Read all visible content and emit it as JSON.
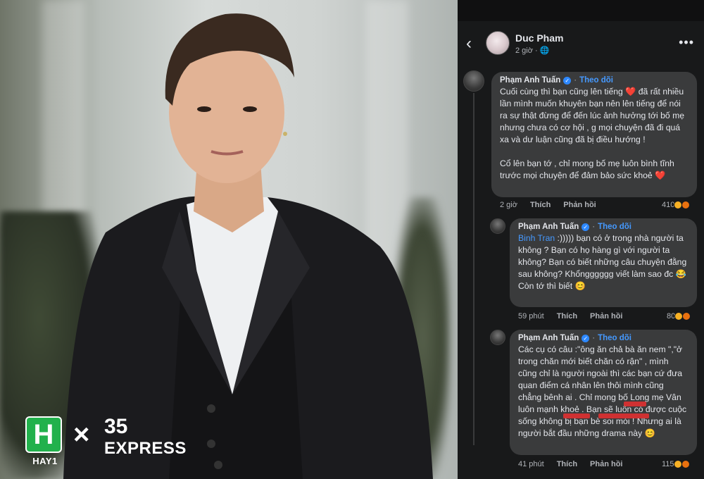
{
  "post": {
    "author": "Duc Pham",
    "meta": "2 giờ ·",
    "back_icon": "back-arrow-icon",
    "more_icon": "more-icon"
  },
  "comments": [
    {
      "name": "Phạm Anh Tuấn",
      "follow": "Theo dõi",
      "text": "Cuối cùng thì bạn cũng lên tiếng ❤️ đã rất nhiều lần mình muốn khuyên bạn nên lên tiếng để nói ra sự thật đừng để đến lúc ảnh hưởng tới bố mẹ nhưng chưa có cơ hội , g mọi chuyện đã đi quá xa và dư luận cũng đã bị điều hướng !\n\nCổ lên bạn tớ , chỉ mong bố mẹ luôn bình tĩnh trước mọi chuyện để đảm bảo sức khoẻ ❤️",
      "time": "2 giờ",
      "like": "Thích",
      "reply": "Phản hồi",
      "reactions": "410"
    },
    {
      "name": "Phạm Anh Tuấn",
      "follow": "Theo dõi",
      "mention": "Binh Tran",
      "text": " :))))) bạn có ở trong nhà người ta không ? Bạn có họ hàng gì với người ta không? Bạn có biết những câu chuyện đằng sau không? Khổngggggg viết làm sao đc 😂\nCòn tớ thì biết 😊",
      "time": "59 phút",
      "like": "Thích",
      "reply": "Phản hồi",
      "reactions": "80"
    },
    {
      "name": "Phạm Anh Tuấn",
      "follow": "Theo dõi",
      "text": "Các cụ có câu :\"ông ăn chả bà ăn nem \",\"ở trong chăn mới biết chăn có rận\" , mình cũng chỉ là người ngoài thì các bạn cứ đưa quan điểm cá nhân lên thôi mình cũng chẳng bênh ai . Chỉ mong bố Long mẹ Vân luôn mạnh khoẻ . Bạn sẽ luôn có được cuộc sống không bị bạn bè soi mói ! Nhưng ai là người bắt đầu những drama này 😊",
      "time": "41 phút",
      "like": "Thích",
      "reply": "Phản hồi",
      "reactions": "115"
    }
  ],
  "branding": {
    "hay1_mark": "H",
    "hay1_label": "HAY1",
    "times": "×",
    "partner_number": "35",
    "partner_name": "EXPRESS"
  }
}
